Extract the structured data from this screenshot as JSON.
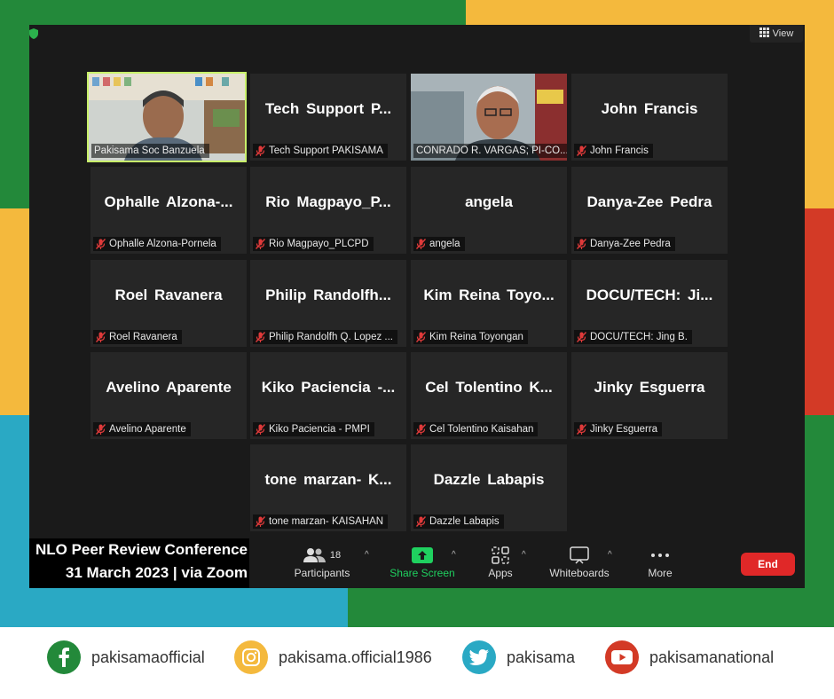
{
  "view_label": "View",
  "tiles": [
    {
      "label": "Pakisama Soc Banzuela",
      "name": ""
    },
    {
      "label": "Tech Support PAKISAMA",
      "name": "Tech Support P..."
    },
    {
      "label": "CONRADO R. VARGAS; PI-CO...",
      "name": ""
    },
    {
      "label": "John Francis",
      "name": "John Francis"
    },
    {
      "label": "Ophalle Alzona-Pornela",
      "name": "Ophalle Alzona-..."
    },
    {
      "label": "Rio Magpayo_PLCPD",
      "name": "Rio Magpayo_P..."
    },
    {
      "label": "angela",
      "name": "angela"
    },
    {
      "label": "Danya-Zee Pedra",
      "name": "Danya-Zee Pedra"
    },
    {
      "label": "Roel Ravanera",
      "name": "Roel Ravanera"
    },
    {
      "label": "Philip Randolfh Q. Lopez ...",
      "name": "Philip Randolfh..."
    },
    {
      "label": "Kim Reina Toyongan",
      "name": "Kim Reina Toyo..."
    },
    {
      "label": "DOCU/TECH: Jing B.",
      "name": "DOCU/TECH: Ji..."
    },
    {
      "label": "Avelino Aparente",
      "name": "Avelino Aparente"
    },
    {
      "label": "Kiko Paciencia - PMPI",
      "name": "Kiko Paciencia -..."
    },
    {
      "label": "Cel Tolentino Kaisahan",
      "name": "Cel Tolentino K..."
    },
    {
      "label": "Jinky Esguerra",
      "name": "Jinky Esguerra"
    },
    {
      "label": "tone marzan- KAISAHAN",
      "name": "tone marzan- K..."
    },
    {
      "label": "Dazzle Labapis",
      "name": "Dazzle Labapis"
    }
  ],
  "toolbar": {
    "participants_label": "Participants",
    "participants_count": "18",
    "share_label": "Share Screen",
    "apps_label": "Apps",
    "whiteboards_label": "Whiteboards",
    "more_label": "More",
    "end_label": "End"
  },
  "caption": {
    "line1": "NLO Peer Review Conference",
    "line2": "31 March 2023 | via Zoom"
  },
  "social": {
    "facebook": "pakisamaofficial",
    "instagram": "pakisama.official1986",
    "twitter": "pakisama",
    "youtube": "pakisamanational"
  },
  "colors": {
    "green": "#23893a",
    "yellow": "#f4b93d",
    "red": "#d33a26",
    "teal": "#2aa9c4",
    "share_green": "#1fd15f",
    "end_red": "#e02828"
  }
}
